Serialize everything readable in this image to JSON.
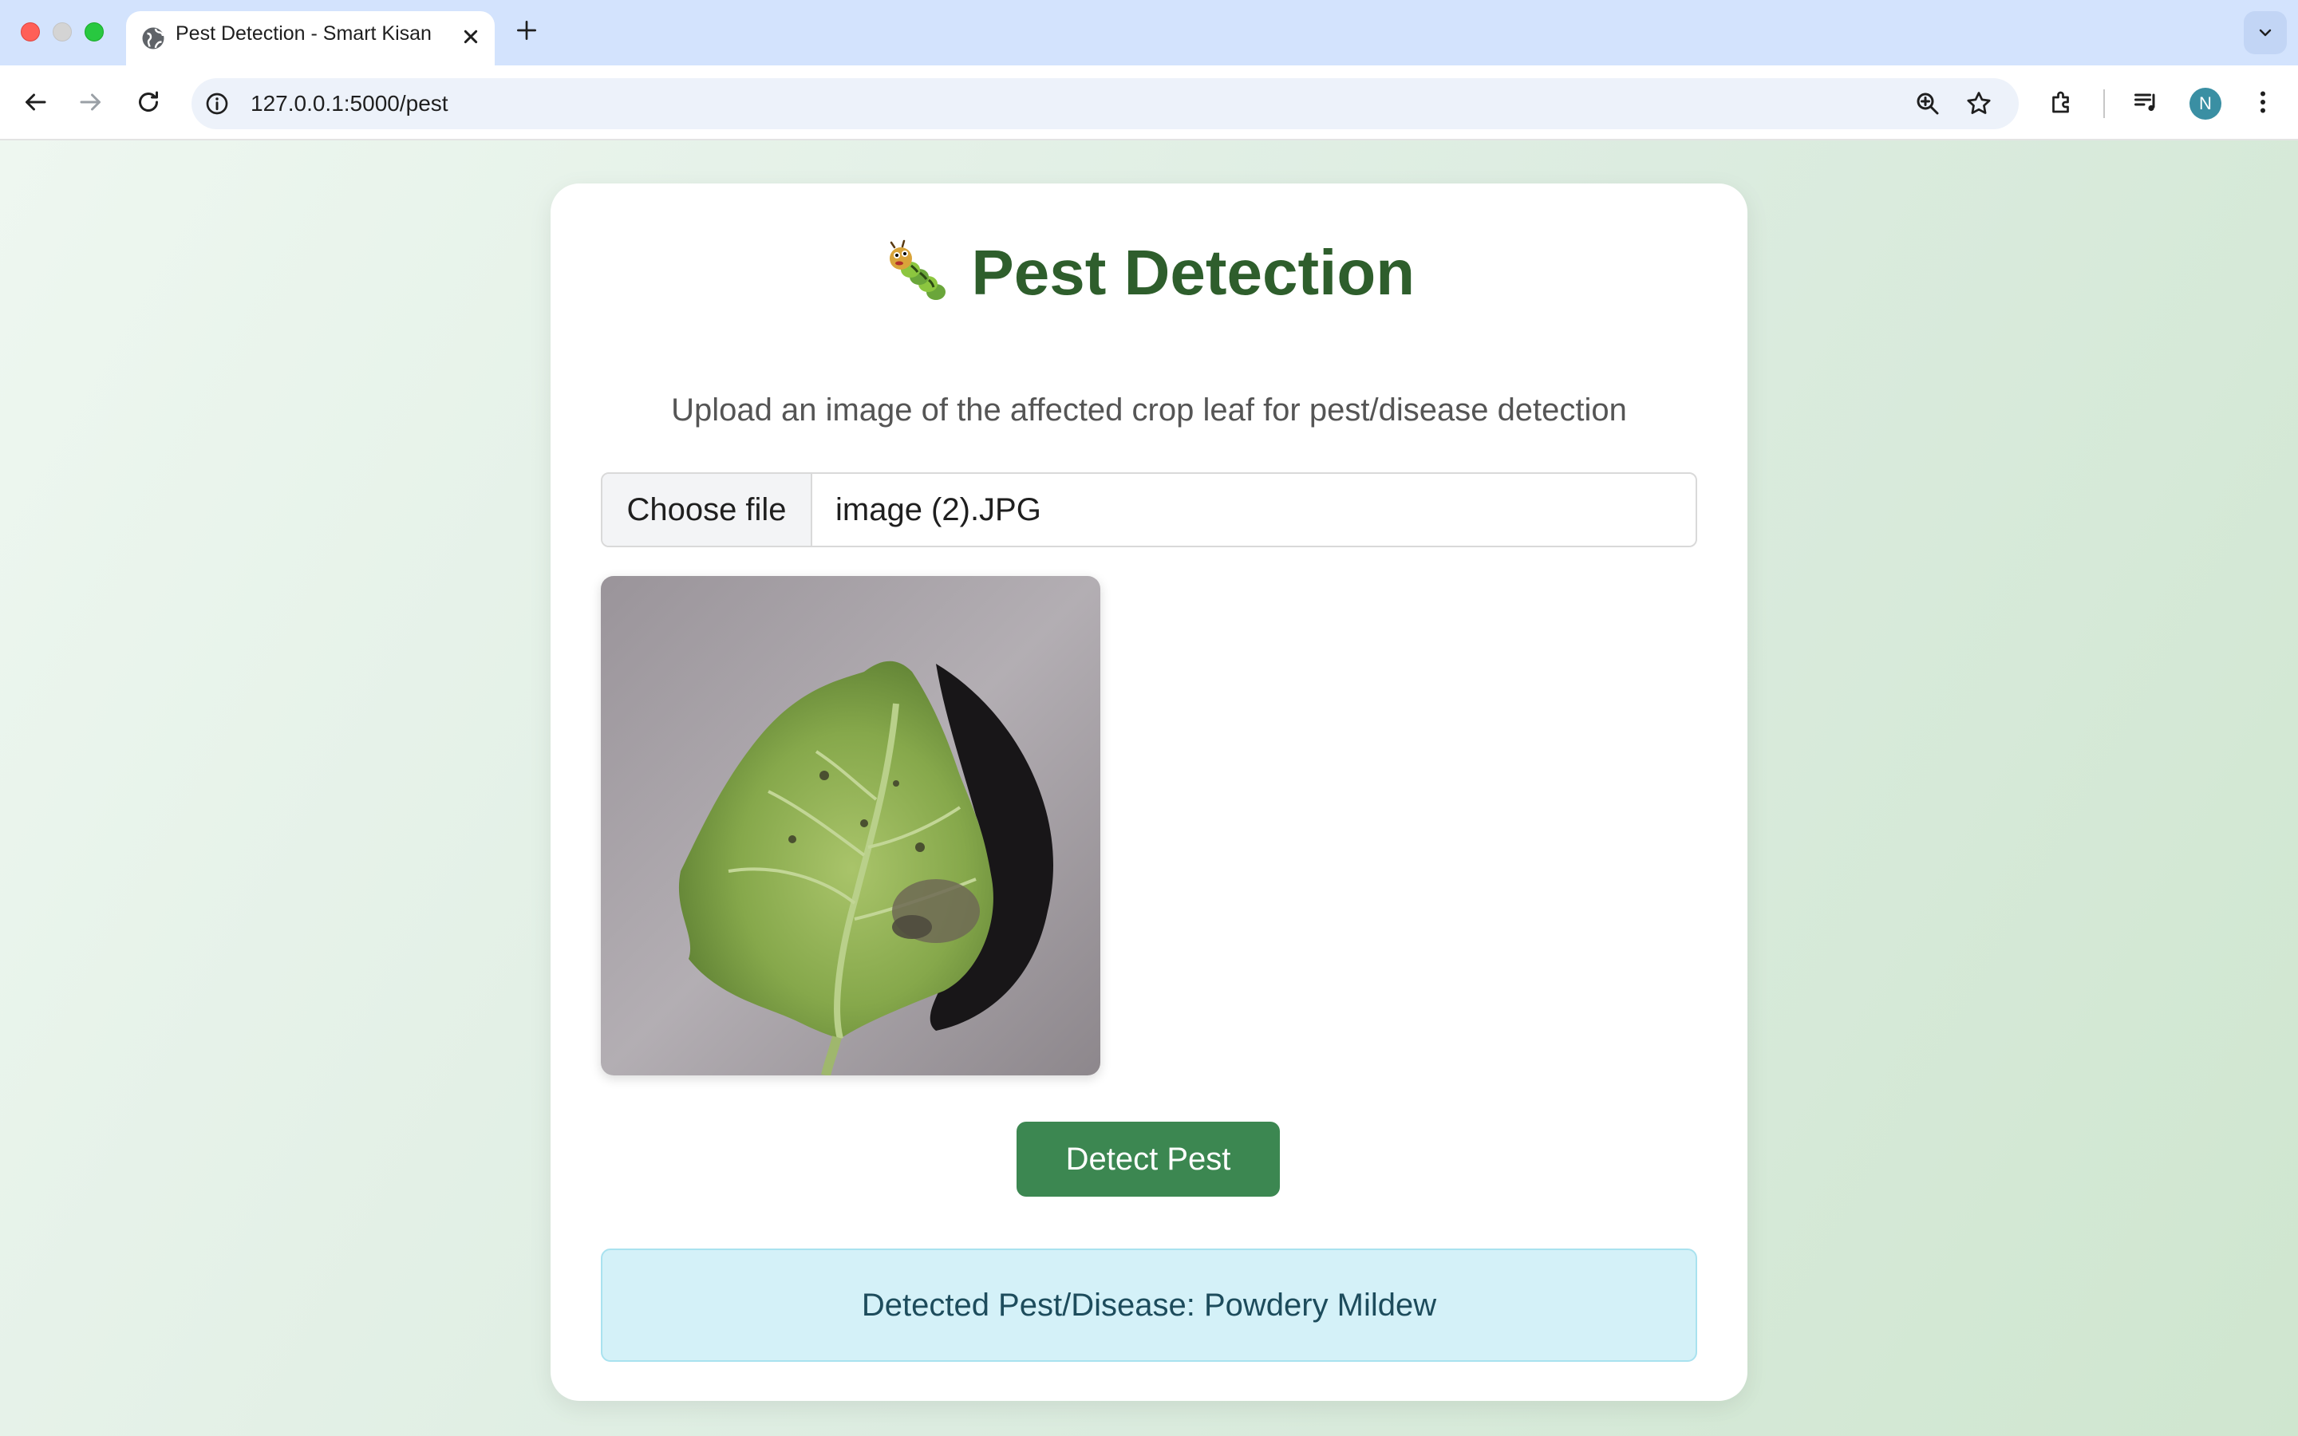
{
  "browser": {
    "tab_title": "Pest Detection - Smart Kisan",
    "url": "127.0.0.1:5000/pest",
    "profile_initial": "N"
  },
  "page": {
    "title": "Pest Detection",
    "title_emoji": "caterpillar-emoji",
    "subtitle": "Upload an image of the affected crop leaf for pest/disease detection",
    "file_button_label": "Choose file",
    "file_name": "image (2).JPG",
    "detect_button_label": "Detect Pest",
    "result_text": "Detected Pest/Disease: Powdery Mildew"
  },
  "colors": {
    "title": "#2e5e2c",
    "button": "#3c8751",
    "result_bg": "#d4f1f8",
    "result_text": "#1d4c5c"
  }
}
